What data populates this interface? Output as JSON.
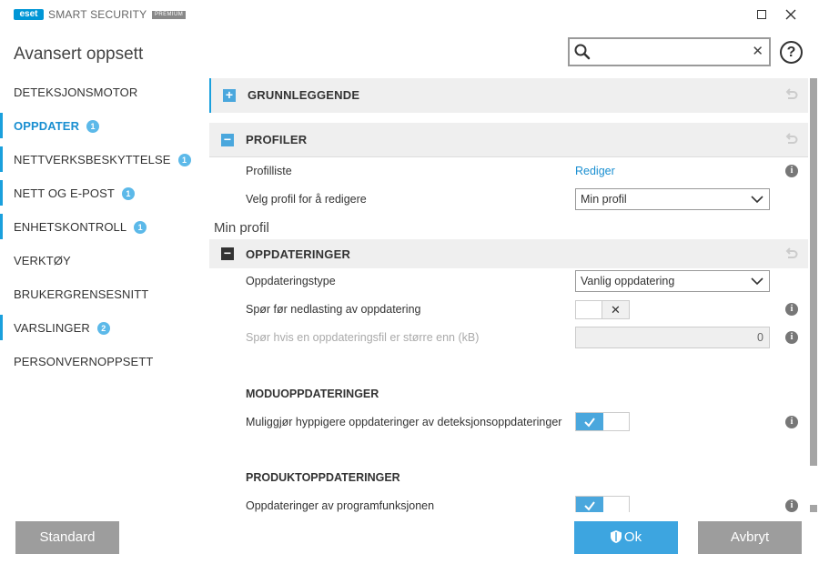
{
  "app": {
    "logo_text": "eset",
    "product": "SMART SECURITY",
    "edition": "PREMIUM"
  },
  "page_title": "Avansert oppsett",
  "search": {
    "placeholder": "",
    "value": ""
  },
  "nav": [
    {
      "label": "DETEKSJONSMOTOR",
      "badge": ""
    },
    {
      "label": "OPPDATER",
      "badge": "1"
    },
    {
      "label": "NETTVERKSBESKYTTELSE",
      "badge": "1"
    },
    {
      "label": "NETT OG E-POST",
      "badge": "1"
    },
    {
      "label": "ENHETSKONTROLL",
      "badge": "1"
    },
    {
      "label": "VERKTØY",
      "badge": ""
    },
    {
      "label": "BRUKERGRENSESNITT",
      "badge": ""
    },
    {
      "label": "VARSLINGER",
      "badge": "2"
    },
    {
      "label": "PERSONVERNOPPSETT",
      "badge": ""
    }
  ],
  "sections": {
    "basic": {
      "title": "GRUNNLEGGENDE"
    },
    "profiles": {
      "title": "PROFILER",
      "profile_list_label": "Profilliste",
      "profile_list_link": "Rediger",
      "select_profile_label": "Velg profil for å redigere",
      "select_profile_value": "Min profil"
    },
    "profile_heading": "Min profil",
    "updates": {
      "title": "OPPDATERINGER",
      "update_type_label": "Oppdateringstype",
      "update_type_value": "Vanlig oppdatering",
      "ask_before_download_label": "Spør før nedlasting av oppdatering",
      "ask_if_larger_label": "Spør hvis en oppdateringsfil er større enn (kB)",
      "ask_if_larger_value": "0"
    },
    "module_updates": {
      "title": "MODUOPPDATERINGER",
      "frequent_label": "Muliggjør hyppigere oppdateringer av deteksjonsoppdateringer"
    },
    "product_updates": {
      "title": "PRODUKTOPPDATERINGER",
      "feature_label": "Oppdateringer av programfunksjonen"
    }
  },
  "buttons": {
    "default": "Standard",
    "ok": "Ok",
    "cancel": "Avbryt"
  },
  "colors": {
    "accent": "#1aa0dd",
    "button_blue": "#3da5e0",
    "button_grey": "#9d9d9d"
  }
}
